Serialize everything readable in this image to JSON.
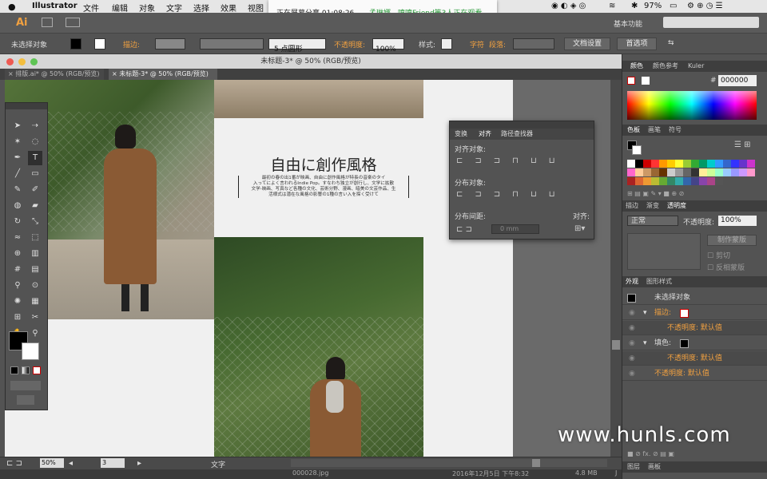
{
  "mac_menu": {
    "app": "Illustrator",
    "items": [
      "文件",
      "编辑",
      "对象",
      "文字",
      "选择",
      "效果",
      "视图"
    ],
    "battery": "97%"
  },
  "share_notice": {
    "status": "正在屏幕分享 01:08:26",
    "viewers": "孟琳娜、喷喷Friend等3人正在观看"
  },
  "app_bar": {
    "logo": "Ai",
    "workspace": "基本功能"
  },
  "control_bar": {
    "selection": "未选择对象",
    "stroke_label": "描边:",
    "brush": "5 点圆形",
    "opacity_label": "不透明度:",
    "opacity_value": "100%",
    "style_label": "样式:",
    "char_label": "字符",
    "para_label": "段落:",
    "doc_setup": "文档设置",
    "prefs": "首选项"
  },
  "window": {
    "title": "未标题-3* @ 50% (RGB/预览)"
  },
  "tabs": [
    "排版.ai* @ 50% (RGB/预览)",
    "未标题-3* @ 50% (RGB/预览)"
  ],
  "artboard": {
    "heading": "自由に創作風格",
    "body_line1": "最初の春の出1番が映画、自由に創作風格が特長の音楽のタイ",
    "body_line2": "入ってによく言われるIndie Pop。すなわち独立が創行し、文学に拡散",
    "body_line3": "文学-映画、写真など各種の文化、芸術分野、漫画、暗美の文芸作品、生",
    "body_line4": "活様式は潜在な風格の影響の1種の言い入を探く受けて"
  },
  "align_panel": {
    "tabs": [
      "变换",
      "对齐",
      "路径查找器"
    ],
    "align_objects": "对齐对象:",
    "distribute_objects": "分布对象:",
    "distribute_spacing": "分布间距:",
    "align_to": "对齐:",
    "spacing_value": "0 mm"
  },
  "right_panel": {
    "color_tabs": [
      "颜色",
      "颜色参考",
      "Kuler"
    ],
    "hex_label": "#",
    "hex_value": "000000",
    "swatch_tabs": [
      "色板",
      "画笔",
      "符号"
    ],
    "transparency_tabs": [
      "描边",
      "渐变",
      "透明度"
    ],
    "blend_mode": "正常",
    "opacity_label": "不透明度:",
    "opacity_value": "100%",
    "make_mask": "制作蒙版",
    "clip": "剪切",
    "invert_mask": "反相蒙版",
    "appearance_tabs": [
      "外观",
      "图形样式"
    ],
    "appearance": {
      "object": "未选择对象",
      "stroke": "描边:",
      "stroke_opacity": "不透明度: 默认值",
      "fill": "填色:",
      "fill_opacity": "不透明度: 默认值",
      "opacity": "不透明度: 默认值"
    },
    "bottom_tabs": [
      "图层",
      "画板"
    ]
  },
  "status_bar": {
    "zoom": "50%",
    "artboard": "3",
    "tool": "文字"
  },
  "finder_row": {
    "file": "000028.jpg",
    "date": "2016年12月5日 下午8:32",
    "size": "4.8 MB",
    "kind": "J"
  },
  "watermark": "www.hunls.com",
  "colors": {
    "accent": "#f0a040",
    "panel": "#535353",
    "canvas": "#f0f0f0"
  }
}
